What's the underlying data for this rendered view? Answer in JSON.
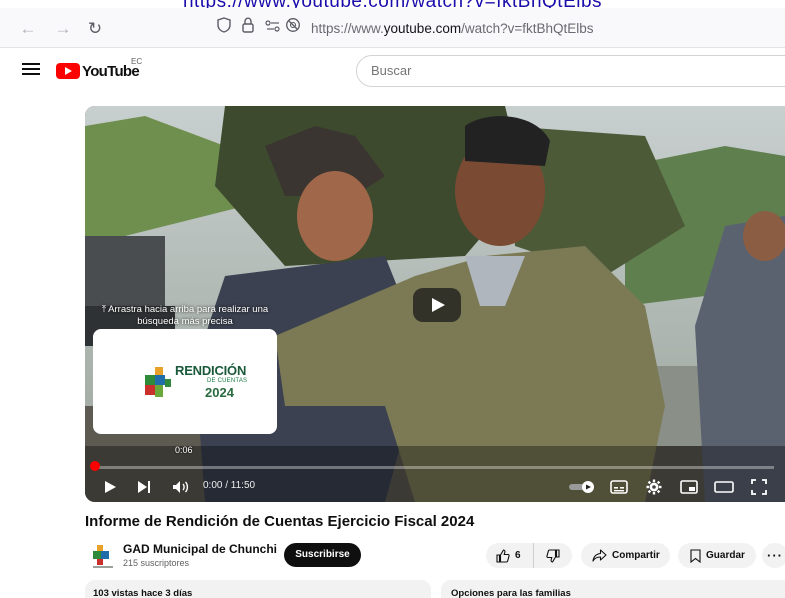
{
  "browser": {
    "top_link": "https://www.youtube.com/watch?v=fktBhQtElbs",
    "url_prefix": "https://www.",
    "url_host": "youtube.com",
    "url_path": "/watch?v=fktBhQtElbs"
  },
  "header": {
    "logo_text": "YouTube",
    "country_code": "EC",
    "search_placeholder": "Buscar"
  },
  "player": {
    "drag_hint_line1": "Arrastra hacia arriba para realizar una",
    "drag_hint_line2": "búsqueda más precisa",
    "thumb_title": "RENDICIÓN",
    "thumb_subtitle": "DE CUENTAS",
    "thumb_year": "2024",
    "preview_time": "0:06",
    "time": "0:00 / 11:50",
    "progress_fraction": 0.0
  },
  "video": {
    "title": "Informe de Rendición de Cuentas Ejercicio Fiscal 2024",
    "channel": "GAD Municipal de Chunchi",
    "subscribers": "215 suscriptores",
    "subscribe_label": "Suscribirse",
    "likes": "6",
    "share_label": "Compartir",
    "save_label": "Guardar",
    "more_label": "···",
    "stats": "103 vistas  hace 3 días",
    "families": "Opciones para las familias"
  },
  "colors": {
    "brand": "#ff0000",
    "subscribe_bg": "#0f0f0f"
  }
}
